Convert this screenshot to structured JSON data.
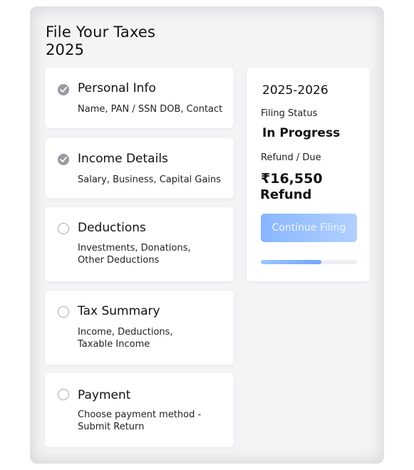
{
  "page": {
    "title": "File Your Taxes 2025"
  },
  "steps": [
    {
      "title": "Personal Info",
      "desc": "Name, PAN / SSN DOB, Contact",
      "status": "done",
      "icon": "check-circle-icon"
    },
    {
      "title": "Income Details",
      "desc": "Salary, Business, Capital Gains",
      "status": "done",
      "icon": "check-circle-icon"
    },
    {
      "title": "Deductions",
      "desc": "Investments, Donations, Other Deductions",
      "status": "todo",
      "icon": "empty-circle-icon"
    },
    {
      "title": "Tax Summary",
      "desc": "Income, Deductions, Taxable Income",
      "status": "todo",
      "icon": "empty-circle-icon"
    },
    {
      "title": "Payment",
      "desc": "Choose payment method - Submit Return",
      "status": "todo",
      "icon": "empty-circle-icon"
    }
  ],
  "summary": {
    "year": "2025-2026",
    "status_label": "Filing Status",
    "status_value": "In Progress",
    "refund_label": "Refund / Due",
    "amount": "₹16,550",
    "amount_type": "Refund",
    "button_label": "Continue Filing",
    "progress": 0.63
  },
  "colors": {
    "accent": "#88b6ff",
    "done_icon": "#9a9aa0"
  }
}
